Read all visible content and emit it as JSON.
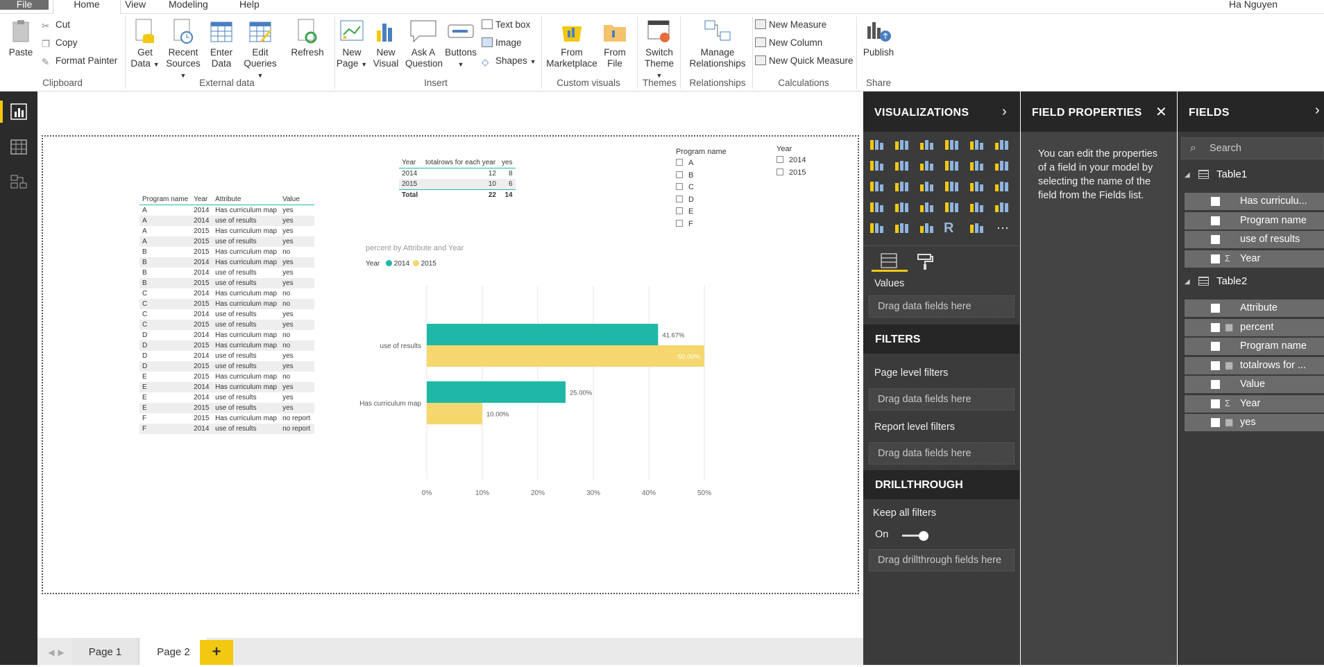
{
  "menu": {
    "tabs": [
      "File",
      "Home",
      "View",
      "Modeling",
      "Help"
    ],
    "user": "Ha Nguyen"
  },
  "ribbon": {
    "clipboard": {
      "paste": "Paste",
      "cut": "Cut",
      "copy": "Copy",
      "format_painter": "Format Painter",
      "label": "Clipboard"
    },
    "external": {
      "get_data_1": "Get",
      "get_data_2": "Data",
      "recent_1": "Recent",
      "recent_2": "Sources",
      "enter_1": "Enter",
      "enter_2": "Data",
      "edit_1": "Edit",
      "edit_2": "Queries",
      "refresh": "Refresh",
      "label": "External data"
    },
    "insert": {
      "newpage_1": "New",
      "newpage_2": "Page",
      "newvisual_1": "New",
      "newvisual_2": "Visual",
      "ask_1": "Ask A",
      "ask_2": "Question",
      "buttons": "Buttons",
      "textbox": "Text box",
      "image": "Image",
      "shapes": "Shapes",
      "label": "Insert"
    },
    "custom": {
      "market_1": "From",
      "market_2": "Marketplace",
      "file_1": "From",
      "file_2": "File",
      "label": "Custom visuals"
    },
    "themes": {
      "switch_1": "Switch",
      "switch_2": "Theme",
      "label": "Themes"
    },
    "relationships": {
      "manage_1": "Manage",
      "manage_2": "Relationships",
      "label": "Relationships"
    },
    "calculations": {
      "new_measure": "New Measure",
      "new_column": "New Column",
      "new_quick": "New Quick Measure",
      "label": "Calculations"
    },
    "share": {
      "publish": "Publish",
      "label": "Share"
    }
  },
  "detail_table": {
    "headers": [
      "Program name",
      "Year",
      "Attribute",
      "Value"
    ],
    "rows": [
      [
        "A",
        "2014",
        "Has curriculum map",
        "yes"
      ],
      [
        "A",
        "2014",
        "use of results",
        "yes"
      ],
      [
        "A",
        "2015",
        "Has curriculum map",
        "yes"
      ],
      [
        "A",
        "2015",
        "use of results",
        "yes"
      ],
      [
        "B",
        "2015",
        "Has curriculum map",
        "no"
      ],
      [
        "B",
        "2014",
        "Has curriculum map",
        "yes"
      ],
      [
        "B",
        "2014",
        "use of results",
        "yes"
      ],
      [
        "B",
        "2015",
        "use of results",
        "yes"
      ],
      [
        "C",
        "2014",
        "Has curriculum map",
        "no"
      ],
      [
        "C",
        "2015",
        "Has curriculum map",
        "no"
      ],
      [
        "C",
        "2014",
        "use of results",
        "yes"
      ],
      [
        "C",
        "2015",
        "use of results",
        "yes"
      ],
      [
        "D",
        "2014",
        "Has curriculum map",
        "no"
      ],
      [
        "D",
        "2015",
        "Has curriculum map",
        "no"
      ],
      [
        "D",
        "2014",
        "use of results",
        "yes"
      ],
      [
        "D",
        "2015",
        "use of results",
        "yes"
      ],
      [
        "E",
        "2015",
        "Has curriculum map",
        "no"
      ],
      [
        "E",
        "2014",
        "Has curriculum map",
        "yes"
      ],
      [
        "E",
        "2014",
        "use of results",
        "yes"
      ],
      [
        "E",
        "2015",
        "use of results",
        "yes"
      ],
      [
        "F",
        "2015",
        "Has curriculum map",
        "no report"
      ],
      [
        "F",
        "2014",
        "use of results",
        "no report"
      ]
    ]
  },
  "summary_table": {
    "headers": [
      "Year",
      "totalrows for each year",
      "yes"
    ],
    "rows": [
      [
        "2014",
        "12",
        "8"
      ],
      [
        "2015",
        "10",
        "6"
      ]
    ],
    "total": [
      "Total",
      "22",
      "14"
    ]
  },
  "slicer_program": {
    "title": "Program name",
    "items": [
      "A",
      "B",
      "C",
      "D",
      "E",
      "F"
    ]
  },
  "slicer_year": {
    "title": "Year",
    "items": [
      "2014",
      "2015"
    ]
  },
  "chart_data": {
    "type": "bar",
    "title": "percent by Attribute and Year",
    "legend_title": "Year",
    "categories": [
      "use of results",
      "Has curriculum map"
    ],
    "series": [
      {
        "name": "2014",
        "values": [
          41.67,
          25.0
        ],
        "labels": [
          "41.67%",
          "25.00%"
        ],
        "color": "#1fb8a6"
      },
      {
        "name": "2015",
        "values": [
          50.0,
          10.0
        ],
        "labels": [
          "50.00%",
          "10.00%"
        ],
        "color": "#f5d76e"
      }
    ],
    "xlim": [
      0,
      50
    ],
    "xticks": [
      "0%",
      "10%",
      "20%",
      "30%",
      "40%",
      "50%"
    ],
    "grid": true,
    "legend_position": "top-left"
  },
  "page_tabs": [
    "Page 1",
    "Page 2"
  ],
  "add_page": "+",
  "visualizations": {
    "title": "VISUALIZATIONS",
    "values_label": "Values",
    "drag_here": "Drag data fields here",
    "filters_title": "FILTERS",
    "page_filters": "Page level filters",
    "report_filters": "Report level filters",
    "drill_title": "DRILLTHROUGH",
    "keep_filters": "Keep all filters",
    "toggle_state": "On",
    "drill_drag": "Drag drillthrough fields here",
    "more": "···"
  },
  "field_properties": {
    "title": "FIELD PROPERTIES",
    "text": "You can edit the properties of a field in your model by selecting the name of the field from the Fields list."
  },
  "fields": {
    "title": "FIELDS",
    "search_placeholder": "Search",
    "tables": [
      {
        "name": "Table1",
        "fields": [
          {
            "name": "Has curriculu...",
            "sym": ""
          },
          {
            "name": "Program name",
            "sym": ""
          },
          {
            "name": "use of results",
            "sym": ""
          },
          {
            "name": "Year",
            "sym": "Σ"
          }
        ]
      },
      {
        "name": "Table2",
        "fields": [
          {
            "name": "Attribute",
            "sym": ""
          },
          {
            "name": "percent",
            "sym": "▦"
          },
          {
            "name": "Program name",
            "sym": ""
          },
          {
            "name": "totalrows for ...",
            "sym": "▦"
          },
          {
            "name": "Value",
            "sym": ""
          },
          {
            "name": "Year",
            "sym": "Σ"
          },
          {
            "name": "yes",
            "sym": "▦"
          }
        ]
      }
    ]
  },
  "colors": {
    "accent": "#f2c811",
    "teal": "#1fb8a6",
    "yellow": "#f5d76e",
    "dark_pane": "#3b3b3b"
  }
}
